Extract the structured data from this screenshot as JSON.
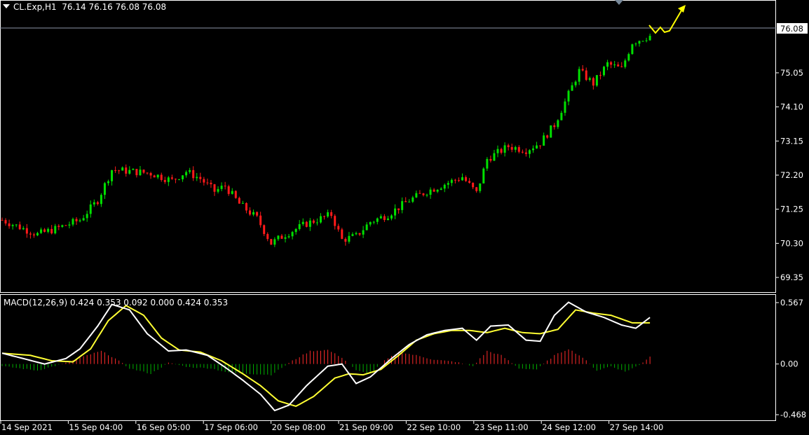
{
  "header": {
    "symbol": "CL.Exp,H1",
    "ohlc": "76.14 76.16 76.08 76.08",
    "macd_label": "MACD(12,26,9) 0.424 0.353 0.092 0.000 0.424 0.353"
  },
  "colors": {
    "background": "#000000",
    "bull_candle": "#00e000",
    "bear_candle": "#ff1a1a",
    "macd_main": "#ffffff",
    "macd_signal": "#ffff33",
    "hist_pos": "#ff2a2a",
    "hist_neg": "#00b000",
    "bid_line": "#8c96a8",
    "arrow": "#ffff00"
  },
  "price_axis": {
    "ticks": [
      "69.35",
      "70.30",
      "71.25",
      "72.20",
      "73.15",
      "74.10",
      "75.05"
    ],
    "current_price": "76.08"
  },
  "macd_axis": {
    "ticks": [
      "0.567",
      "0.00",
      "-0.468"
    ]
  },
  "time_axis": {
    "labels": [
      "14 Sep 2021",
      "15 Sep 04:00",
      "16 Sep 05:00",
      "17 Sep 06:00",
      "20 Sep 08:00",
      "21 Sep 09:00",
      "22 Sep 10:00",
      "23 Sep 11:00",
      "24 Sep 12:00",
      "27 Sep 14:00"
    ]
  },
  "chart_data": [
    {
      "type": "candlestick",
      "title": "CL.Exp,H1",
      "ylim": [
        69.0,
        77.0
      ],
      "anchors_close": [
        [
          0,
          70.95
        ],
        [
          10,
          70.55
        ],
        [
          15,
          70.7
        ],
        [
          22,
          70.95
        ],
        [
          27,
          71.5
        ],
        [
          31,
          72.35
        ],
        [
          37,
          72.3
        ],
        [
          42,
          72.25
        ],
        [
          48,
          72.05
        ],
        [
          52,
          72.3
        ],
        [
          56,
          72.1
        ],
        [
          60,
          71.75
        ],
        [
          63,
          71.9
        ],
        [
          67,
          71.4
        ],
        [
          72,
          71.0
        ],
        [
          76,
          70.3
        ],
        [
          80,
          70.55
        ],
        [
          86,
          70.85
        ],
        [
          93,
          71.1
        ],
        [
          96,
          70.4
        ],
        [
          100,
          70.5
        ],
        [
          104,
          70.9
        ],
        [
          109,
          71.1
        ],
        [
          115,
          71.5
        ],
        [
          120,
          71.75
        ],
        [
          125,
          71.95
        ],
        [
          130,
          72.15
        ],
        [
          134,
          71.7
        ],
        [
          137,
          72.65
        ],
        [
          143,
          73.0
        ],
        [
          148,
          72.9
        ],
        [
          152,
          73.1
        ],
        [
          156,
          73.6
        ],
        [
          160,
          74.45
        ],
        [
          163,
          75.1
        ],
        [
          167,
          74.75
        ],
        [
          171,
          75.3
        ],
        [
          175,
          75.15
        ],
        [
          178,
          75.9
        ],
        [
          183,
          76.08
        ]
      ],
      "annotations": [
        "up-arrow forecast"
      ]
    },
    {
      "type": "line",
      "title": "MACD(12,26,9)",
      "ylim": [
        -0.468,
        0.567
      ],
      "series": [
        {
          "name": "MACD main",
          "points": [
            [
              0,
              0.1
            ],
            [
              6,
              0.05
            ],
            [
              12,
              0.0
            ],
            [
              18,
              0.05
            ],
            [
              22,
              0.14
            ],
            [
              27,
              0.35
            ],
            [
              31,
              0.55
            ],
            [
              36,
              0.5
            ],
            [
              41,
              0.28
            ],
            [
              47,
              0.12
            ],
            [
              52,
              0.13
            ],
            [
              58,
              0.08
            ],
            [
              63,
              -0.03
            ],
            [
              68,
              -0.15
            ],
            [
              73,
              -0.28
            ],
            [
              77,
              -0.43
            ],
            [
              81,
              -0.38
            ],
            [
              86,
              -0.2
            ],
            [
              92,
              -0.02
            ],
            [
              96,
              0.0
            ],
            [
              100,
              -0.18
            ],
            [
              104,
              -0.12
            ],
            [
              110,
              0.05
            ],
            [
              115,
              0.18
            ],
            [
              120,
              0.27
            ],
            [
              125,
              0.31
            ],
            [
              130,
              0.33
            ],
            [
              134,
              0.22
            ],
            [
              138,
              0.35
            ],
            [
              143,
              0.36
            ],
            [
              148,
              0.22
            ],
            [
              152,
              0.21
            ],
            [
              156,
              0.45
            ],
            [
              160,
              0.57
            ],
            [
              165,
              0.48
            ],
            [
              170,
              0.43
            ],
            [
              175,
              0.36
            ],
            [
              179,
              0.33
            ],
            [
              183,
              0.43
            ]
          ]
        },
        {
          "name": "MACD signal",
          "points": [
            [
              0,
              0.1
            ],
            [
              8,
              0.08
            ],
            [
              14,
              0.03
            ],
            [
              20,
              0.02
            ],
            [
              25,
              0.14
            ],
            [
              30,
              0.4
            ],
            [
              35,
              0.54
            ],
            [
              40,
              0.45
            ],
            [
              45,
              0.24
            ],
            [
              50,
              0.13
            ],
            [
              56,
              0.11
            ],
            [
              62,
              0.03
            ],
            [
              68,
              -0.09
            ],
            [
              73,
              -0.2
            ],
            [
              78,
              -0.34
            ],
            [
              83,
              -0.39
            ],
            [
              88,
              -0.3
            ],
            [
              94,
              -0.13
            ],
            [
              98,
              -0.09
            ],
            [
              102,
              -0.1
            ],
            [
              107,
              -0.05
            ],
            [
              112,
              0.08
            ],
            [
              117,
              0.22
            ],
            [
              122,
              0.28
            ],
            [
              127,
              0.31
            ],
            [
              132,
              0.31
            ],
            [
              137,
              0.29
            ],
            [
              142,
              0.33
            ],
            [
              147,
              0.29
            ],
            [
              152,
              0.28
            ],
            [
              157,
              0.32
            ],
            [
              162,
              0.5
            ],
            [
              167,
              0.47
            ],
            [
              172,
              0.45
            ],
            [
              178,
              0.38
            ],
            [
              183,
              0.38
            ]
          ]
        },
        {
          "name": "Histogram",
          "points": [
            [
              0,
              -0.02
            ],
            [
              10,
              -0.06
            ],
            [
              18,
              0.01
            ],
            [
              24,
              0.08
            ],
            [
              28,
              0.12
            ],
            [
              32,
              0.05
            ],
            [
              36,
              -0.04
            ],
            [
              42,
              -0.09
            ],
            [
              47,
              0.01
            ],
            [
              53,
              -0.03
            ],
            [
              59,
              -0.04
            ],
            [
              64,
              -0.08
            ],
            [
              70,
              -0.09
            ],
            [
              76,
              -0.1
            ],
            [
              82,
              0.03
            ],
            [
              87,
              0.12
            ],
            [
              92,
              0.13
            ],
            [
              96,
              0.06
            ],
            [
              100,
              -0.06
            ],
            [
              104,
              -0.09
            ],
            [
              108,
              0.03
            ],
            [
              112,
              0.11
            ],
            [
              117,
              0.08
            ],
            [
              122,
              0.04
            ],
            [
              128,
              0.02
            ],
            [
              133,
              -0.02
            ],
            [
              137,
              0.12
            ],
            [
              141,
              0.08
            ],
            [
              146,
              -0.04
            ],
            [
              151,
              -0.05
            ],
            [
              156,
              0.08
            ],
            [
              160,
              0.14
            ],
            [
              164,
              0.06
            ],
            [
              168,
              -0.06
            ],
            [
              172,
              -0.02
            ],
            [
              176,
              -0.07
            ],
            [
              180,
              -0.01
            ],
            [
              183,
              0.07
            ]
          ]
        }
      ]
    }
  ]
}
